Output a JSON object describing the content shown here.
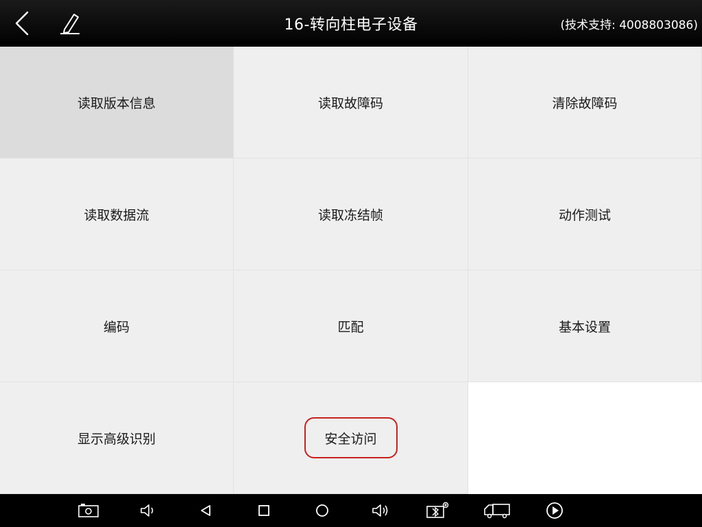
{
  "header": {
    "title": "16-转向柱电子设备",
    "support": "(技术支持: 4008803086)",
    "back_icon": "chevron-left-icon",
    "edit_icon": "pencil-icon"
  },
  "menu": {
    "items": [
      {
        "label": "读取版本信息"
      },
      {
        "label": "读取故障码"
      },
      {
        "label": "清除故障码"
      },
      {
        "label": "读取数据流"
      },
      {
        "label": "读取冻结帧"
      },
      {
        "label": "动作测试"
      },
      {
        "label": "编码"
      },
      {
        "label": "匹配"
      },
      {
        "label": "基本设置"
      },
      {
        "label": "显示高级识别"
      },
      {
        "label": "安全访问"
      }
    ],
    "highlight_color": "#c9211e"
  },
  "navbar": {
    "icons": [
      "screenshot-icon",
      "volume-down-icon",
      "back-triangle-icon",
      "recent-apps-icon",
      "home-circle-icon",
      "volume-up-icon",
      "bluetooth-vci-icon",
      "truck-icon",
      "play-icon"
    ]
  }
}
